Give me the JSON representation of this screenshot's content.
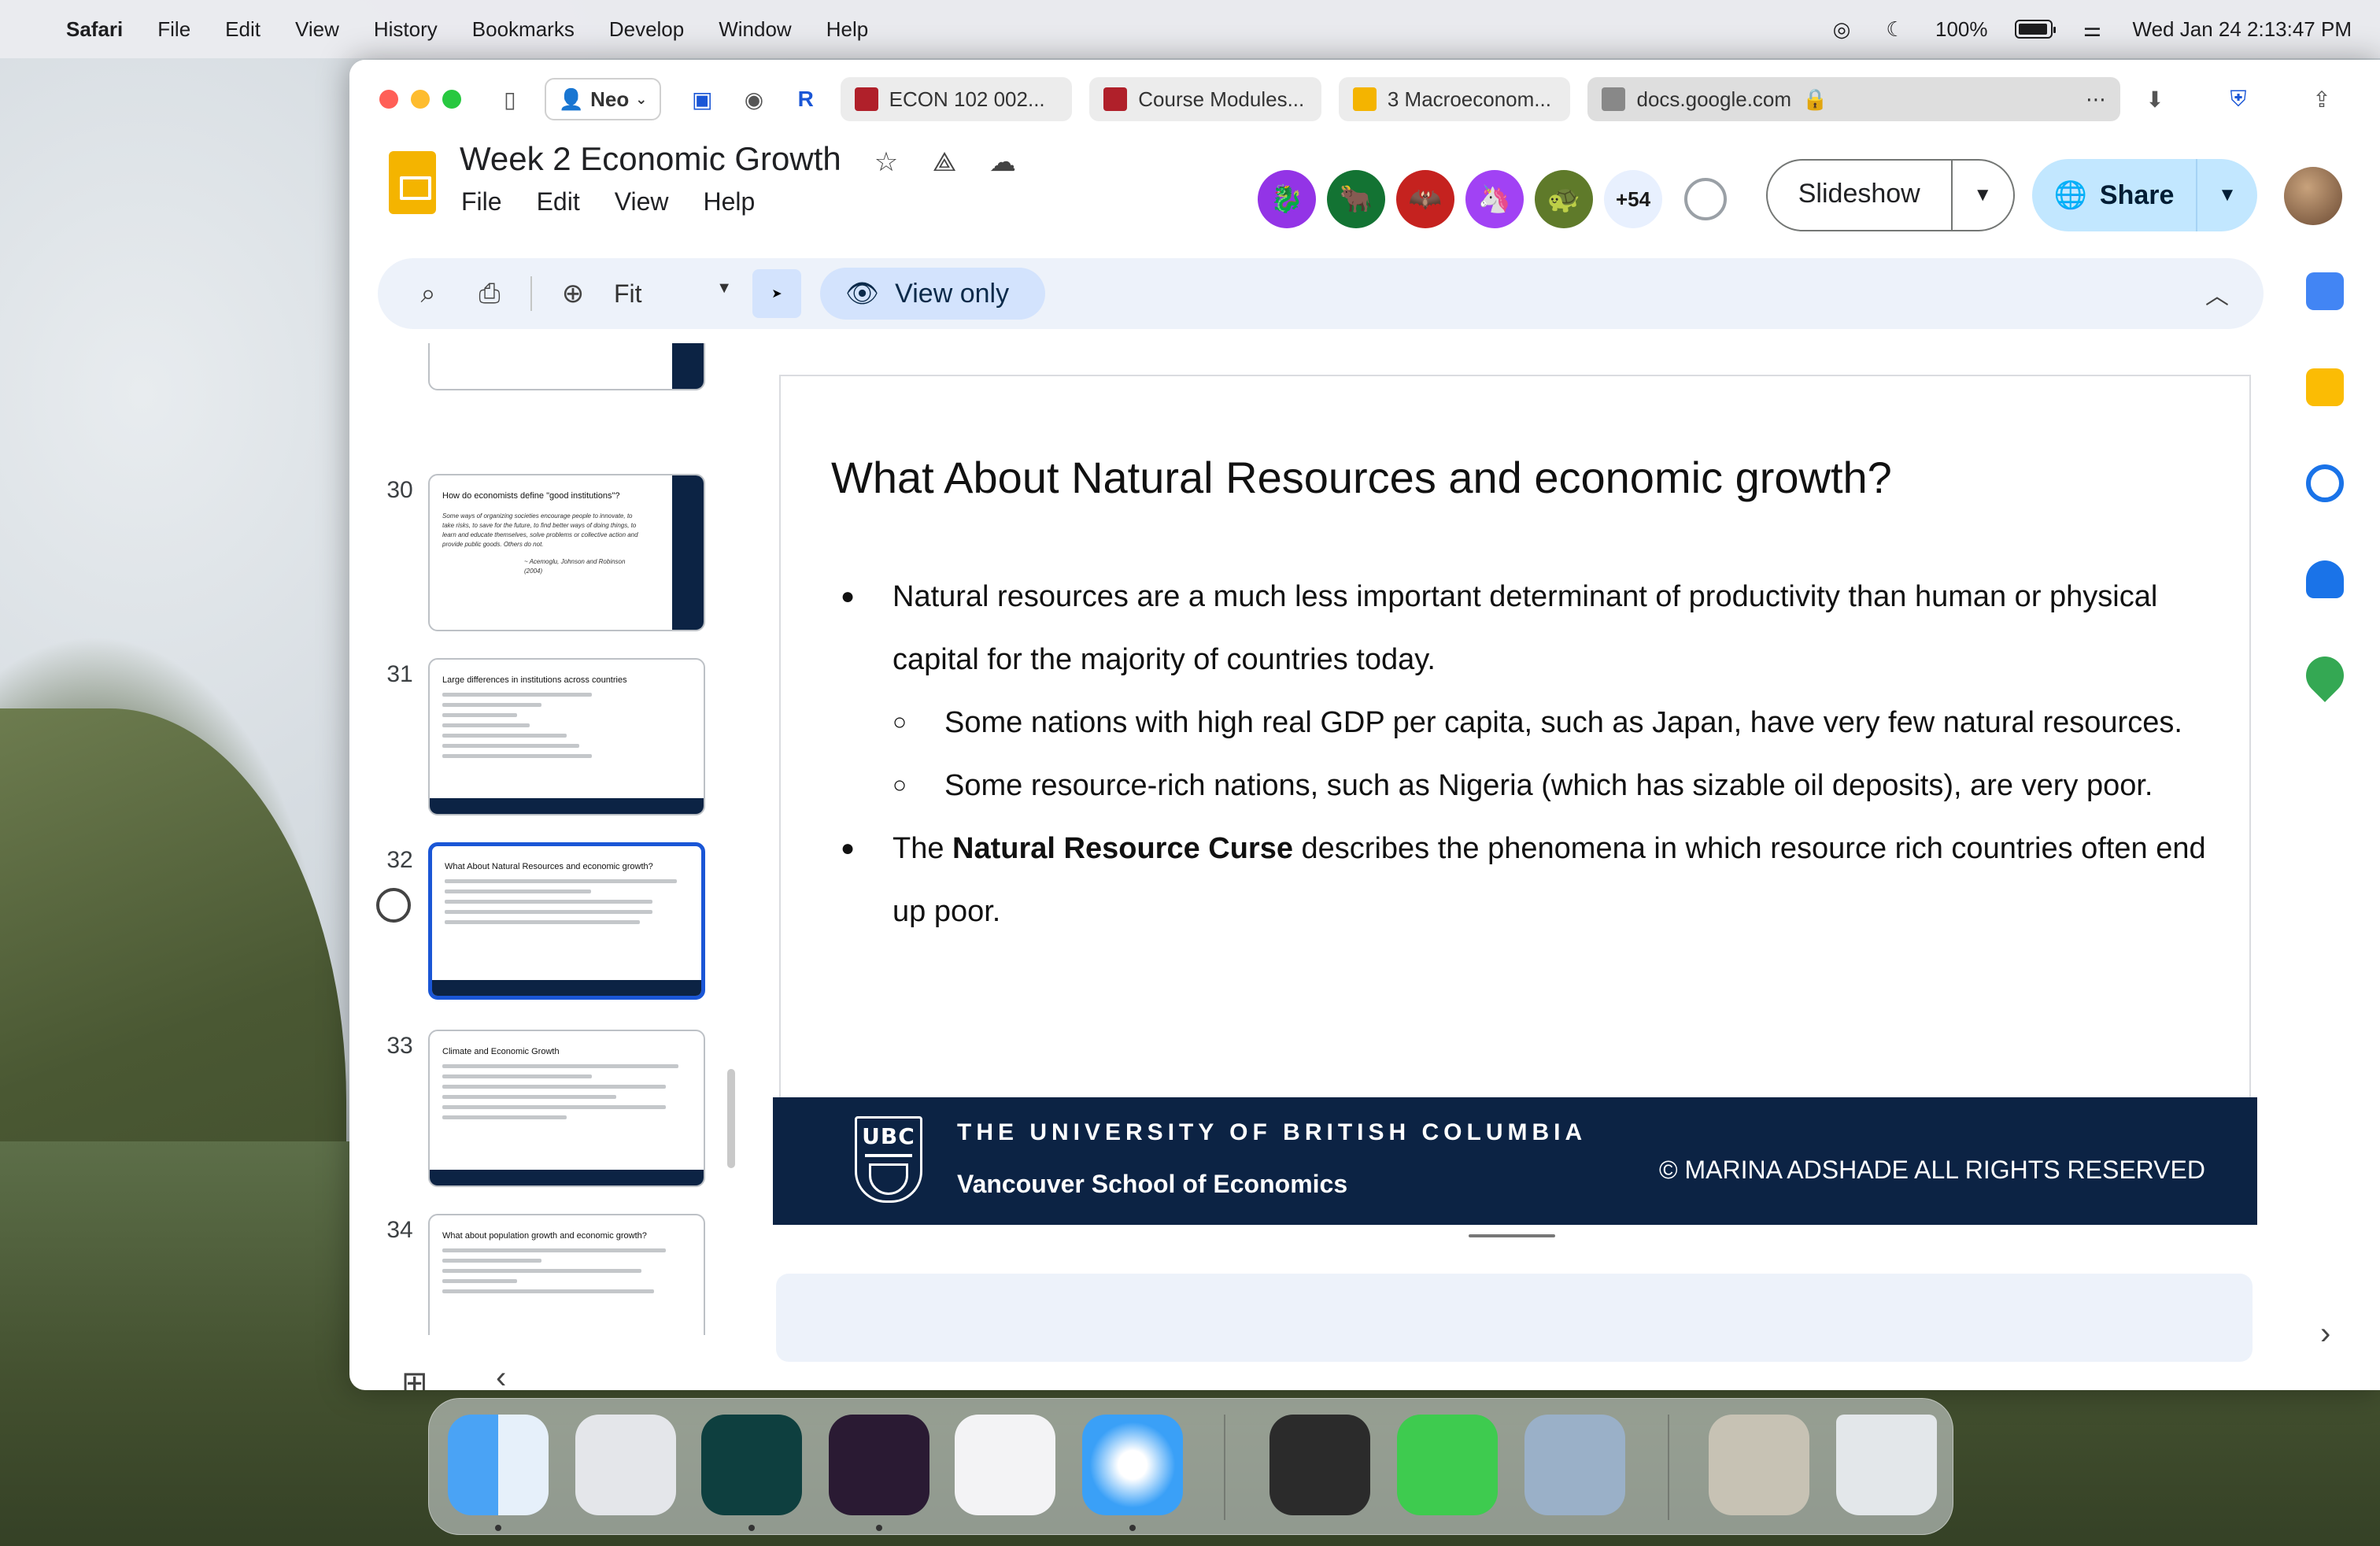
{
  "menubar": {
    "app": "Safari",
    "items": [
      "File",
      "Edit",
      "View",
      "History",
      "Bookmarks",
      "Develop",
      "Window",
      "Help"
    ],
    "battery": "100%",
    "datetime": "Wed Jan 24  2:13:47 PM"
  },
  "browser": {
    "profile": "Neo",
    "tabs": [
      {
        "label": "ECON 102 002...",
        "color": "#b0202a"
      },
      {
        "label": "Course Modules...",
        "color": "#b0202a"
      },
      {
        "label": "3 Macroeconom...",
        "color": "#f4b400"
      }
    ],
    "active_tab": "docs.google.com"
  },
  "docs": {
    "title": "Week 2 Economic Growth",
    "menu": [
      "File",
      "Edit",
      "View",
      "Help"
    ],
    "collaborators_more": "+54",
    "slideshow_label": "Slideshow",
    "share_label": "Share"
  },
  "toolbar": {
    "zoom": "Fit",
    "view_only_label": "View only"
  },
  "filmstrip": [
    {
      "number": "30",
      "title": "How do economists define \"good institutions\"?",
      "quote": "Some ways of organizing societies encourage people to innovate, to take risks, to save for the future, to find better ways of doing things, to learn and educate themselves, solve problems or collective action and provide public goods. Others do not.",
      "attribution": "~ Acemoglu, Johnson and Robinson (2004)"
    },
    {
      "number": "31",
      "title": "Large differences in institutions across countries"
    },
    {
      "number": "32",
      "title": "What About Natural Resources and economic growth?"
    },
    {
      "number": "33",
      "title": "Climate and Economic Growth"
    },
    {
      "number": "34",
      "title": "What about population growth and economic growth?"
    }
  ],
  "slide": {
    "title": "What About Natural Resources and economic growth?",
    "bullet1": "Natural resources are a much less important determinant of productivity than human or physical capital for the majority of countries today.",
    "sub1": "Some nations with high real GDP per capita, such as Japan, have very few natural resources.",
    "sub2": "Some resource-rich nations, such as Nigeria (which has sizable oil deposits), are very poor.",
    "bullet2_prefix": "The ",
    "bullet2_bold": "Natural Resource Curse",
    "bullet2_suffix": " describes the phenomena in which resource rich countries often end up poor.",
    "footer_logo": "UBC",
    "footer_university": "THE UNIVERSITY OF BRITISH COLUMBIA",
    "footer_school": "Vancouver School of Economics",
    "footer_copyright": "© MARINA ADSHADE ALL RIGHTS RESERVED"
  },
  "dock": [
    "Finder",
    "Launchpad",
    "Bluesky",
    "Power",
    "Copilot",
    "Safari",
    "Bear",
    "Messages",
    "Preview",
    "Photos",
    "Trash"
  ]
}
